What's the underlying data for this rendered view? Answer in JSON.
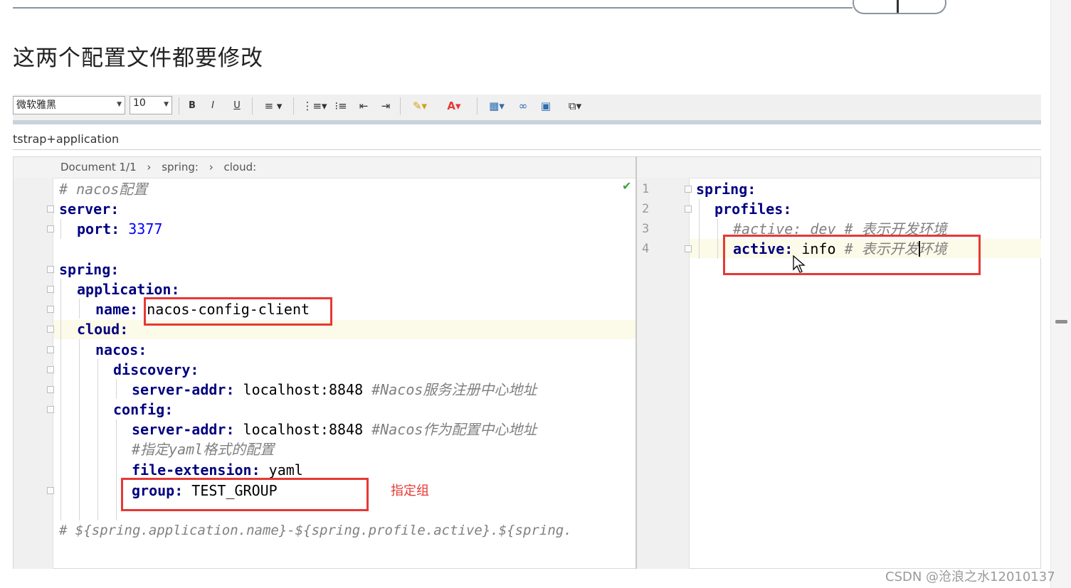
{
  "heading": "这两个配置文件都要修改",
  "toolbar": {
    "font_name": "微软雅黑",
    "font_size": "10",
    "bold": "B",
    "italic": "I",
    "underline": "U"
  },
  "title_crumb": "tstrap+application",
  "breadcrumb": [
    "Document 1/1",
    "›",
    "spring:",
    "›",
    "cloud:"
  ],
  "left_code": {
    "comment1": "# nacos配置",
    "server": "server:",
    "port_key": "port:",
    "port_val": "3377",
    "spring": "spring:",
    "application": "application:",
    "name_key": "name:",
    "name_val": "nacos-config-client",
    "cloud": "cloud:",
    "nacos": "nacos:",
    "discovery": "discovery:",
    "disc_addr_key": "server-addr:",
    "disc_addr_val": "localhost:8848",
    "disc_comment": "#Nacos服务注册中心地址",
    "config": "config:",
    "cfg_addr_key": "server-addr:",
    "cfg_addr_val": "localhost:8848",
    "cfg_comment": "#Nacos作为配置中心地址",
    "yaml_comment": "#指定yaml格式的配置",
    "ext_key": "file-extension:",
    "ext_val": "yaml",
    "group_key": "group:",
    "group_val": "TEST_GROUP",
    "footer_comment": "# ${spring.application.name}-${spring.profile.active}.${spring."
  },
  "annotation": "指定组",
  "right_code": {
    "line_numbers": [
      "1",
      "2",
      "3",
      "4"
    ],
    "spring": "spring:",
    "profiles": "profiles:",
    "commented_active": "#active: dev # 表示开发环境",
    "active_key": "active:",
    "active_val": "info",
    "active_comment": "# 表示开发环境"
  },
  "watermark": "CSDN @沧浪之水12010137",
  "colors": {
    "highlight_box": "#e53935",
    "yaml_key": "#000080",
    "number": "#0000ff",
    "comment": "#808080",
    "current_line": "#fcfae8"
  }
}
